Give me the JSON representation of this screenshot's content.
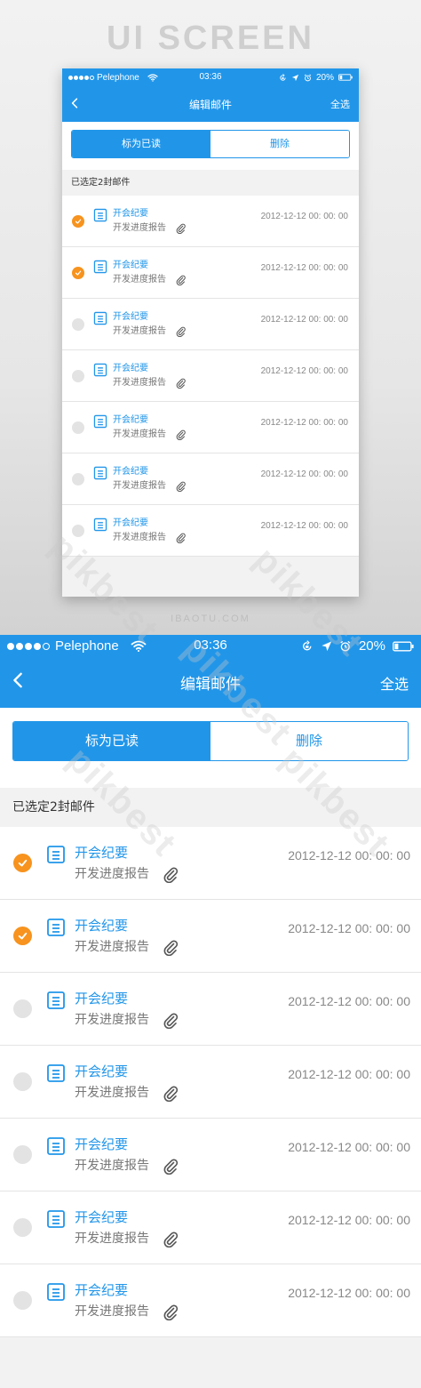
{
  "preview": {
    "title": "UI SCREEN",
    "footer": "IBAOTU.COM"
  },
  "status_bar": {
    "carrier": "Pelephone",
    "time": "03:36",
    "battery": "20%"
  },
  "nav": {
    "back_icon": "chevron-left-icon",
    "title": "编辑邮件",
    "right_action": "全选"
  },
  "segment": {
    "mark_read": "标为已读",
    "delete": "删除"
  },
  "selection_info": "已选定2封邮件",
  "mails": [
    {
      "subject": "开会纪要",
      "preview": "开发进度报告",
      "date": "2012-12-12 00: 00: 00",
      "checked": true
    },
    {
      "subject": "开会纪要",
      "preview": "开发进度报告",
      "date": "2012-12-12 00: 00: 00",
      "checked": true
    },
    {
      "subject": "开会纪要",
      "preview": "开发进度报告",
      "date": "2012-12-12 00: 00: 00",
      "checked": false
    },
    {
      "subject": "开会纪要",
      "preview": "开发进度报告",
      "date": "2012-12-12 00: 00: 00",
      "checked": false
    },
    {
      "subject": "开会纪要",
      "preview": "开发进度报告",
      "date": "2012-12-12 00: 00: 00",
      "checked": false
    },
    {
      "subject": "开会纪要",
      "preview": "开发进度报告",
      "date": "2012-12-12 00: 00: 00",
      "checked": false
    },
    {
      "subject": "开会纪要",
      "preview": "开发进度报告",
      "date": "2012-12-12 00: 00: 00",
      "checked": false
    }
  ],
  "watermark": "pikbest",
  "colors": {
    "primary": "#2196e9",
    "check_on": "#f7931e",
    "check_off": "#e3e3e3",
    "background": "#f2f2f2"
  }
}
